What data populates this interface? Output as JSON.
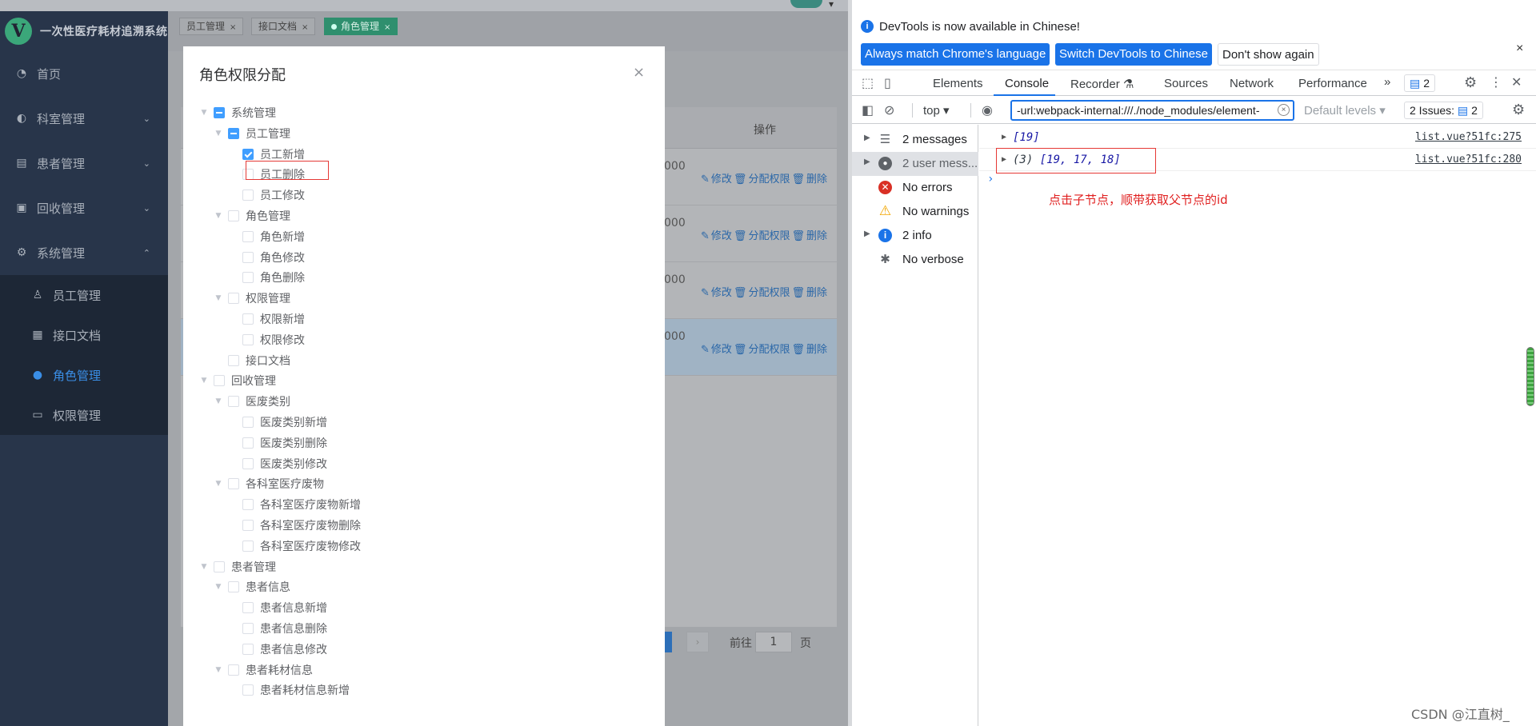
{
  "app": {
    "title": "一次性医疗耗材追溯系统",
    "logo_letter": "V",
    "menu": [
      {
        "label": "首页",
        "icon": "dashboard-icon"
      },
      {
        "label": "科室管理",
        "icon": "department-icon"
      },
      {
        "label": "患者管理",
        "icon": "patient-icon"
      },
      {
        "label": "回收管理",
        "icon": "recycle-icon"
      },
      {
        "label": "系统管理",
        "icon": "gear-icon"
      }
    ],
    "submenu": [
      {
        "label": "员工管理",
        "icon": "user-icon"
      },
      {
        "label": "接口文档",
        "icon": "grid-icon"
      },
      {
        "label": "角色管理",
        "icon": "role-icon"
      },
      {
        "label": "权限管理",
        "icon": "monitor-icon"
      }
    ],
    "tabs": [
      {
        "label": "员工管理"
      },
      {
        "label": "接口文档"
      },
      {
        "label": "角色管理"
      }
    ],
    "table": {
      "op_header": "操作",
      "rows": [
        {
          "num": "000",
          "edit": "修改",
          "assign": "分配权限",
          "delete": "删除"
        },
        {
          "num": "000",
          "edit": "修改",
          "assign": "分配权限",
          "delete": "删除"
        },
        {
          "num": "000",
          "edit": "修改",
          "assign": "分配权限",
          "delete": "删除"
        },
        {
          "num": "000",
          "edit": "修改",
          "assign": "分配权限",
          "delete": "删除"
        }
      ]
    },
    "pager": {
      "goto": "前往",
      "page": "1",
      "unit": "页"
    }
  },
  "modal": {
    "title": "角色权限分配",
    "close": "×",
    "tree": [
      {
        "label": "系统管理",
        "level": 0,
        "expanded": true,
        "state": "indeterminate"
      },
      {
        "label": "员工管理",
        "level": 1,
        "expanded": true,
        "state": "indeterminate"
      },
      {
        "label": "员工新增",
        "level": 2,
        "state": "checked"
      },
      {
        "label": "员工删除",
        "level": 2,
        "state": "unchecked"
      },
      {
        "label": "员工修改",
        "level": 2,
        "state": "unchecked"
      },
      {
        "label": "角色管理",
        "level": 1,
        "expanded": true,
        "state": "unchecked"
      },
      {
        "label": "角色新增",
        "level": 2,
        "state": "unchecked"
      },
      {
        "label": "角色修改",
        "level": 2,
        "state": "unchecked"
      },
      {
        "label": "角色删除",
        "level": 2,
        "state": "unchecked"
      },
      {
        "label": "权限管理",
        "level": 1,
        "expanded": true,
        "state": "unchecked"
      },
      {
        "label": "权限新增",
        "level": 2,
        "state": "unchecked"
      },
      {
        "label": "权限修改",
        "level": 2,
        "state": "unchecked"
      },
      {
        "label": "接口文档",
        "level": 1,
        "state": "unchecked"
      },
      {
        "label": "回收管理",
        "level": 0,
        "expanded": true,
        "state": "unchecked"
      },
      {
        "label": "医废类别",
        "level": 1,
        "expanded": true,
        "state": "unchecked"
      },
      {
        "label": "医废类别新增",
        "level": 2,
        "state": "unchecked"
      },
      {
        "label": "医废类别删除",
        "level": 2,
        "state": "unchecked"
      },
      {
        "label": "医废类别修改",
        "level": 2,
        "state": "unchecked"
      },
      {
        "label": "各科室医疗废物",
        "level": 1,
        "expanded": true,
        "state": "unchecked"
      },
      {
        "label": "各科室医疗废物新增",
        "level": 2,
        "state": "unchecked"
      },
      {
        "label": "各科室医疗废物删除",
        "level": 2,
        "state": "unchecked"
      },
      {
        "label": "各科室医疗废物修改",
        "level": 2,
        "state": "unchecked"
      },
      {
        "label": "患者管理",
        "level": 0,
        "expanded": true,
        "state": "unchecked"
      },
      {
        "label": "患者信息",
        "level": 1,
        "expanded": true,
        "state": "unchecked"
      },
      {
        "label": "患者信息新增",
        "level": 2,
        "state": "unchecked"
      },
      {
        "label": "患者信息删除",
        "level": 2,
        "state": "unchecked"
      },
      {
        "label": "患者信息修改",
        "level": 2,
        "state": "unchecked"
      },
      {
        "label": "患者耗材信息",
        "level": 1,
        "expanded": true,
        "state": "unchecked"
      },
      {
        "label": "患者耗材信息新增",
        "level": 2,
        "state": "unchecked"
      }
    ]
  },
  "devtools": {
    "infobar": {
      "text": "DevTools is now available in Chinese!",
      "btn_match": "Always match Chrome's language",
      "btn_switch": "Switch DevTools to Chinese",
      "btn_dont": "Don't show again",
      "close": "×"
    },
    "tabs": [
      "Elements",
      "Console",
      "Recorder ⚗",
      "Sources",
      "Network",
      "Performance"
    ],
    "more_tabs": "»",
    "issues_badge": "2",
    "toolbar": {
      "context": "top ▾",
      "filter_value": "-url:webpack-internal:///./node_modules/element-",
      "levels": "Default levels ▾",
      "issues_label": "2 Issues:",
      "issues_count": "2"
    },
    "sidebar": [
      {
        "label": "2 messages",
        "icon": "list-icon",
        "expandable": true,
        "selected": false
      },
      {
        "label": "2 user mess...",
        "icon": "user-icon",
        "expandable": true,
        "selected": true
      },
      {
        "label": "No errors",
        "icon": "error-icon",
        "expandable": false,
        "selected": false
      },
      {
        "label": "No warnings",
        "icon": "warning-icon",
        "expandable": false,
        "selected": false
      },
      {
        "label": "2 info",
        "icon": "info-icon",
        "expandable": true,
        "selected": false
      },
      {
        "label": "No verbose",
        "icon": "bug-icon",
        "expandable": false,
        "selected": false
      }
    ],
    "logs": [
      {
        "value": "[19]",
        "count": "",
        "source": "list.vue?51fc:275"
      },
      {
        "value": "[19, 17, 18]",
        "count": "(3) ",
        "source": "list.vue?51fc:280"
      }
    ],
    "prompt": "›",
    "annotation": "点击子节点，顺带获取父节点的id"
  },
  "watermark": "CSDN @江直树_",
  "colors": {
    "sidebar_bg": "#28354a",
    "active_menu": "#3a8ee6",
    "checkbox_blue": "#409eff",
    "devtools_blue": "#1a73e8",
    "annotation_red": "#e02020"
  }
}
